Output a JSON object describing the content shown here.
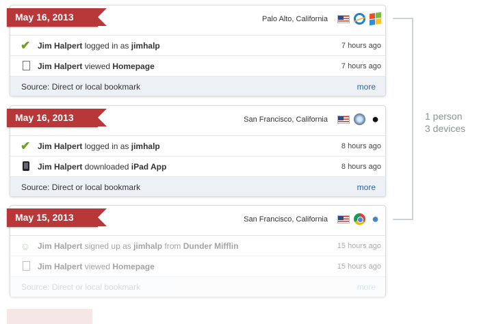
{
  "cards": [
    {
      "date": "May 16, 2013",
      "location": "Palo Alto, California",
      "icons": [
        "us-flag-icon",
        "internet-explorer-icon",
        "windows-icon"
      ],
      "rows": [
        {
          "icon": "checkmark-icon",
          "actor": "Jim Halpert",
          "verb": " logged in as ",
          "object": "jimhalp",
          "time": "7 hours ago"
        },
        {
          "icon": "document-icon",
          "actor": "Jim Halpert",
          "verb": " viewed ",
          "object": "Homepage",
          "time": "7 hours ago"
        }
      ],
      "source": "Source: Direct or local bookmark",
      "more": "more"
    },
    {
      "date": "May 16, 2013",
      "location": "San Francisco, California",
      "icons": [
        "us-flag-icon",
        "safari-icon",
        "apple-icon"
      ],
      "rows": [
        {
          "icon": "checkmark-icon",
          "actor": "Jim Halpert",
          "verb": " logged in as ",
          "object": "jimhalp",
          "time": "8 hours ago"
        },
        {
          "icon": "ipad-icon",
          "actor": "Jim Halpert",
          "verb": " downloaded ",
          "object": "iPad App",
          "time": "8 hours ago"
        }
      ],
      "source": "Source: Direct or local bookmark",
      "more": "more"
    },
    {
      "date": "May 15, 2013",
      "location": "San Francisco, California",
      "icons": [
        "us-flag-icon",
        "chrome-icon",
        "apple-icon"
      ],
      "rows": [
        {
          "icon": "user-add-icon",
          "actor": "Jim Halpert",
          "verb": " signed up as ",
          "object": "jimhalp",
          "verb2": " from ",
          "object2": "Dunder Mifflin",
          "time": "15 hours ago"
        },
        {
          "icon": "document-icon",
          "actor": "Jim Halpert",
          "verb": " viewed ",
          "object": "Homepage",
          "time": "15 hours ago"
        }
      ],
      "source": "Source: Direct or local bookmark",
      "more": "more"
    }
  ],
  "summary": {
    "line1": "1 person",
    "line2": "3 devices"
  },
  "colors": {
    "ribbon": "#b8383a",
    "link": "#2a64a8",
    "footer": "#edf1f5",
    "check": "#6aa321"
  }
}
